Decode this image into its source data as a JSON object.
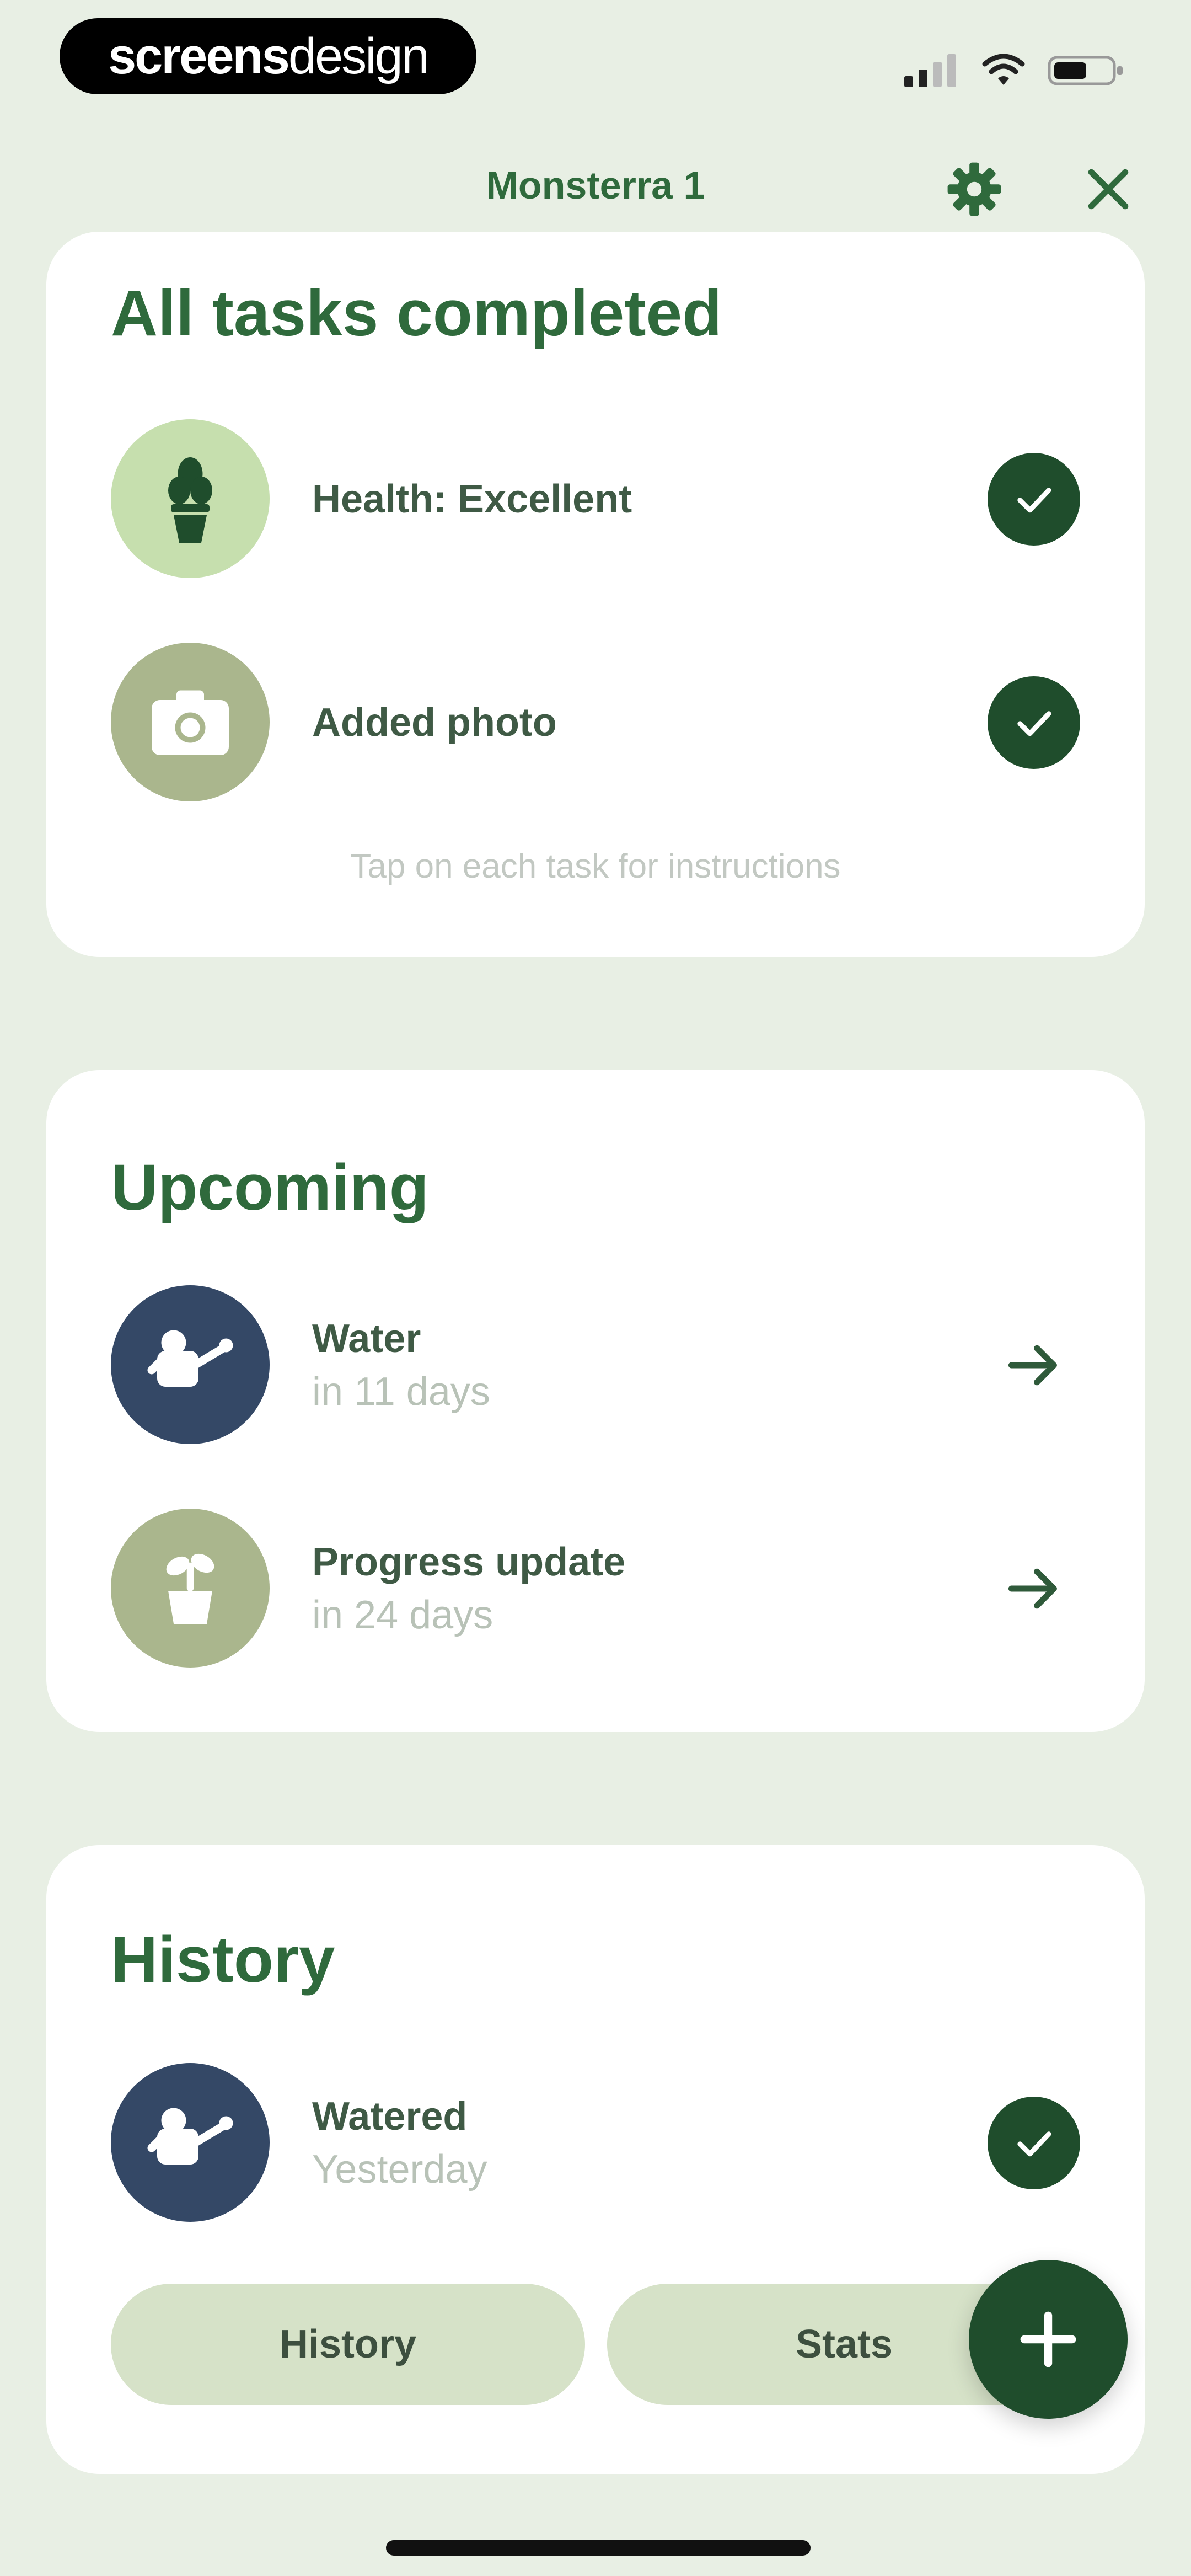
{
  "status": {
    "brand_bold": "screens",
    "brand_light": "design"
  },
  "header": {
    "title": "Monsterra 1"
  },
  "tasks_card": {
    "title": "All tasks completed",
    "items": [
      {
        "label": "Health: Excellent",
        "icon": "potted-plant-icon",
        "color": "#c6dfae"
      },
      {
        "label": "Added photo",
        "icon": "camera-icon",
        "color": "#aab68d"
      }
    ],
    "hint": "Tap on each task for instructions"
  },
  "upcoming_card": {
    "title": "Upcoming",
    "items": [
      {
        "label": "Water",
        "sub": "in 11 days",
        "icon": "watering-can-icon",
        "color": "#344866"
      },
      {
        "label": "Progress update",
        "sub": "in 24 days",
        "icon": "sprout-pot-icon",
        "color": "#aab68d"
      }
    ]
  },
  "history_card": {
    "title": "History",
    "items": [
      {
        "label": "Watered",
        "sub": "Yesterday",
        "icon": "watering-can-icon",
        "color": "#344866"
      }
    ],
    "buttons": {
      "history": "History",
      "stats": "Stats"
    }
  },
  "colors": {
    "background": "#e8efe4",
    "primary_green": "#2f6a3c",
    "dark_green": "#1f4d2c",
    "navy": "#344866",
    "sage": "#aab68d",
    "light_green": "#c6dfae"
  }
}
